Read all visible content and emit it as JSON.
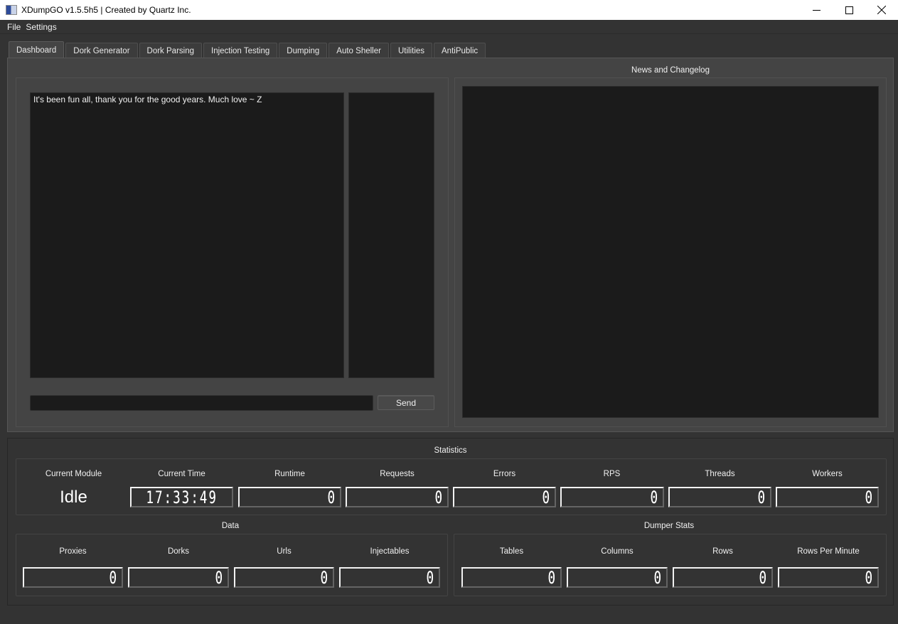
{
  "window": {
    "title": "XDumpGO v1.5.5h5 | Created by Quartz Inc.",
    "controls": [
      "minimize-icon",
      "maximize-icon",
      "close-icon"
    ]
  },
  "menu": {
    "items": [
      "File",
      "Settings"
    ]
  },
  "tabs": [
    {
      "label": "Dashboard",
      "active": true
    },
    {
      "label": "Dork Generator",
      "active": false
    },
    {
      "label": "Dork Parsing",
      "active": false
    },
    {
      "label": "Injection Testing",
      "active": false
    },
    {
      "label": "Dumping",
      "active": false
    },
    {
      "label": "Auto Sheller",
      "active": false
    },
    {
      "label": "Utilities",
      "active": false
    },
    {
      "label": "AntiPublic",
      "active": false
    }
  ],
  "dashboard": {
    "chat": {
      "messages": [
        "It's been fun all, thank you for the good years.  Much love ~ Z"
      ],
      "input_value": "",
      "send_label": "Send"
    },
    "news": {
      "title": "News and Changelog",
      "content": ""
    }
  },
  "statistics": {
    "title": "Statistics",
    "current_module": {
      "label": "Current Module",
      "value": "Idle"
    },
    "current_time": {
      "label": "Current Time",
      "value": "17:33:49"
    },
    "counters": [
      {
        "label": "Runtime",
        "value": "0"
      },
      {
        "label": "Requests",
        "value": "0"
      },
      {
        "label": "Errors",
        "value": "0"
      },
      {
        "label": "RPS",
        "value": "0"
      },
      {
        "label": "Threads",
        "value": "0"
      },
      {
        "label": "Workers",
        "value": "0"
      }
    ]
  },
  "data_stats": {
    "title": "Data",
    "counters": [
      {
        "label": "Proxies",
        "value": "0"
      },
      {
        "label": "Dorks",
        "value": "0"
      },
      {
        "label": "Urls",
        "value": "0"
      },
      {
        "label": "Injectables",
        "value": "0"
      }
    ]
  },
  "dumper_stats": {
    "title": "Dumper Stats",
    "counters": [
      {
        "label": "Tables",
        "value": "0"
      },
      {
        "label": "Columns",
        "value": "0"
      },
      {
        "label": "Rows",
        "value": "0"
      },
      {
        "label": "Rows Per Minute",
        "value": "0"
      }
    ]
  }
}
